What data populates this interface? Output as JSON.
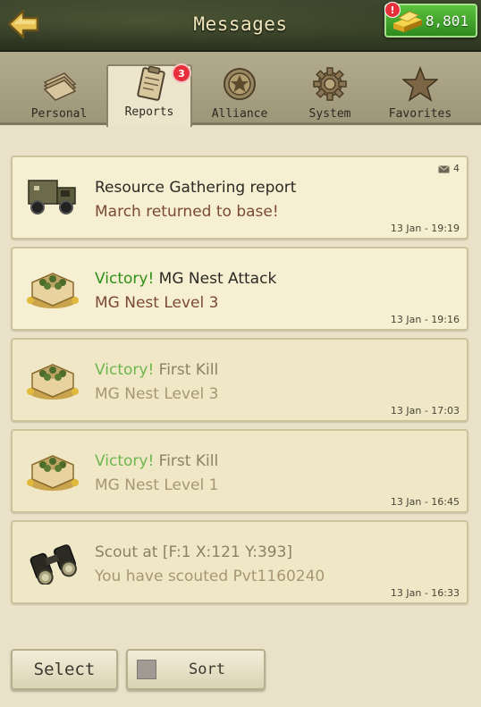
{
  "header": {
    "title": "Messages",
    "gold": "8,801",
    "gold_alert": "!"
  },
  "tabs": [
    {
      "label": "Personal",
      "icon": "envelope-stack-icon"
    },
    {
      "label": "Reports",
      "icon": "clipboard-icon",
      "badge": "3",
      "active": true
    },
    {
      "label": "Alliance",
      "icon": "star-emblem-icon"
    },
    {
      "label": "System",
      "icon": "gear-icon"
    },
    {
      "label": "Favorites",
      "icon": "star-icon"
    }
  ],
  "messages": [
    {
      "icon": "truck-icon",
      "prefix": "",
      "title": "Resource Gathering report",
      "subtitle": "March returned to base!",
      "time": "13 Jan - 19:19",
      "mail_count": "4",
      "read": false
    },
    {
      "icon": "mg-nest-icon",
      "prefix": "Victory!",
      "title": " MG Nest Attack",
      "subtitle": "MG Nest Level 3",
      "time": "13 Jan - 19:16",
      "read": false
    },
    {
      "icon": "mg-nest-icon",
      "prefix": "Victory!",
      "title": " First Kill",
      "subtitle": "MG Nest Level 3",
      "time": "13 Jan - 17:03",
      "read": true
    },
    {
      "icon": "mg-nest-icon",
      "prefix": "Victory!",
      "title": " First Kill",
      "subtitle": "MG Nest Level 1",
      "time": "13 Jan - 16:45",
      "read": true
    },
    {
      "icon": "binoculars-icon",
      "prefix": "",
      "title": "Scout at [F:1  X:121  Y:393]",
      "subtitle": "You have scouted Pvt1160240",
      "time": "13 Jan - 16:33",
      "read": true
    }
  ],
  "footer": {
    "select_label": "Select",
    "sort_label": "Sort"
  },
  "colors": {
    "victory": "#2e8f16",
    "badge": "#e8303c",
    "gold_button": "#3ea52a"
  }
}
